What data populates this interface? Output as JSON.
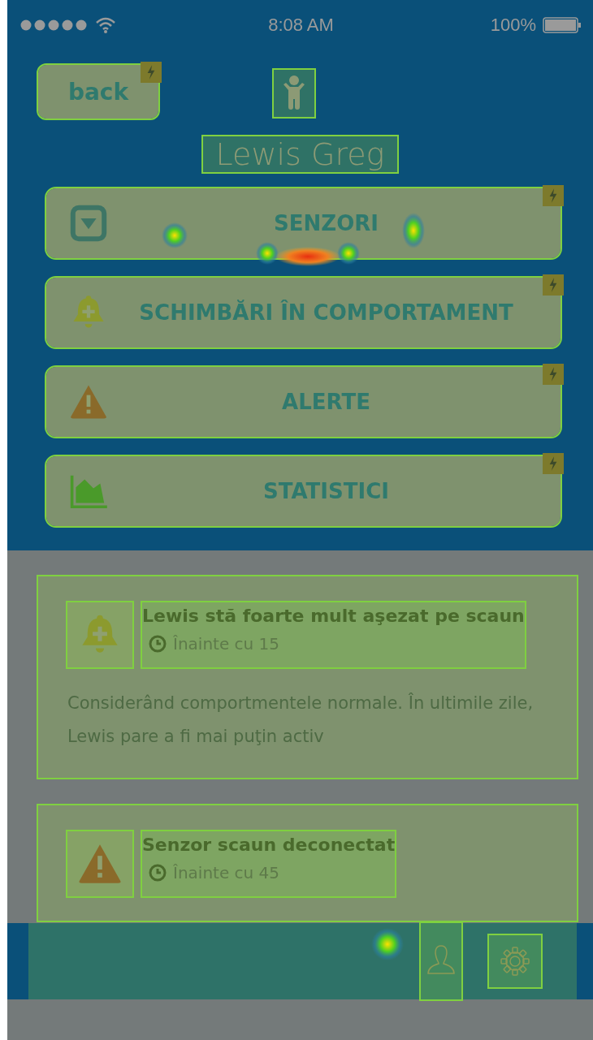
{
  "status_bar": {
    "time": "8:08 AM",
    "battery": "100%"
  },
  "header": {
    "back": "back",
    "name": "Lewis Greg"
  },
  "menu": [
    {
      "label": "SENZORI",
      "kind": "dropdown"
    },
    {
      "label": "SCHIMBĂRI ÎN COMPORTAMENT",
      "kind": "bell"
    },
    {
      "label": "ALERTE",
      "kind": "warning"
    },
    {
      "label": "STATISTICI",
      "kind": "chart"
    }
  ],
  "cards": [
    {
      "kind": "bell",
      "title": "Lewis stă foarte mult aşezat pe scaun",
      "time": "Înainte cu 15",
      "description": "Considerând comportmentele normale. În ultimile zile, Lewis pare a fi mai puţin activ"
    },
    {
      "kind": "warning",
      "title": "Senzor scaun deconectat",
      "time": "Înainte cu 45"
    }
  ]
}
